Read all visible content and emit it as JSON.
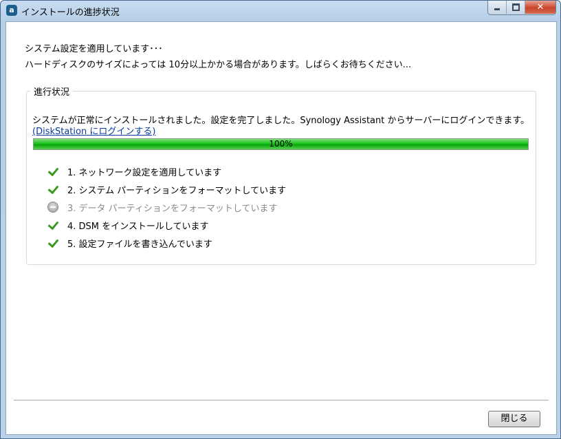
{
  "window": {
    "title": "インストールの進捗状況",
    "close_glyph": "✕"
  },
  "message": {
    "line1": "システム設定を適用しています･･･",
    "line2": "ハードディスクのサイズによっては 10分以上かかる場合があります。しばらくお待ちください..."
  },
  "progress_group": {
    "legend": "進行状況",
    "status": "システムが正常にインストールされました。設定を完了しました。Synology Assistant からサーバーにログインできます。",
    "link": "(DiskStation にログインする)",
    "progress_label": "100%",
    "progress_fraction": 1.0,
    "steps": [
      {
        "label": "1. ネットワーク設定を適用しています",
        "state": "done",
        "icon": "check-icon"
      },
      {
        "label": "2. システム パーティションをフォーマットしています",
        "state": "done",
        "icon": "check-icon"
      },
      {
        "label": "3. データ パーティションをフォーマットしています",
        "state": "skipped",
        "icon": "skip-icon"
      },
      {
        "label": "4. DSM をインストールしています",
        "state": "done",
        "icon": "check-icon"
      },
      {
        "label": "5. 設定ファイルを書き込んでいます",
        "state": "done",
        "icon": "check-icon"
      }
    ]
  },
  "footer": {
    "close_button": "閉じる"
  },
  "colors": {
    "progress_green": "#18c21a",
    "check_green": "#3a9a1e",
    "link": "#0b3a9e"
  }
}
